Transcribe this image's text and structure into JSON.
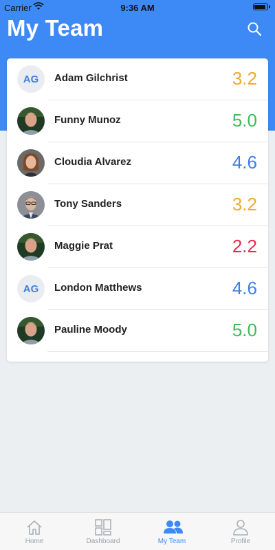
{
  "status": {
    "carrier": "Carrier",
    "time": "9:36 AM"
  },
  "header": {
    "title": "My Team"
  },
  "colors": {
    "accent": "#3d8af7",
    "rating_orange": "#f0a830",
    "rating_green": "#3fba58",
    "rating_blue": "#3d7fe0",
    "rating_red": "#e8294a"
  },
  "members": [
    {
      "name": "Adam Gilchrist",
      "rating": "3.2",
      "rating_color": "#f0a830",
      "avatar": "initials",
      "initials": "AG"
    },
    {
      "name": "Funny Munoz",
      "rating": "5.0",
      "rating_color": "#3fba58",
      "avatar": "photo-man-icon"
    },
    {
      "name": "Cloudia Alvarez",
      "rating": "4.6",
      "rating_color": "#3d7fe0",
      "avatar": "photo-woman-icon"
    },
    {
      "name": "Tony Sanders",
      "rating": "3.2",
      "rating_color": "#f0a830",
      "avatar": "photo-man-glasses-icon"
    },
    {
      "name": "Maggie Prat",
      "rating": "2.2",
      "rating_color": "#e8294a",
      "avatar": "photo-man-icon"
    },
    {
      "name": "London Matthews",
      "rating": "4.6",
      "rating_color": "#3d7fe0",
      "avatar": "initials",
      "initials": "AG"
    },
    {
      "name": "Pauline Moody",
      "rating": "5.0",
      "rating_color": "#3fba58",
      "avatar": "photo-man-icon"
    }
  ],
  "tabs": [
    {
      "label": "Home",
      "icon": "home-icon",
      "active": false
    },
    {
      "label": "Dashboard",
      "icon": "dashboard-icon",
      "active": false
    },
    {
      "label": "My Team",
      "icon": "team-icon",
      "active": true
    },
    {
      "label": "Profile",
      "icon": "profile-icon",
      "active": false
    }
  ]
}
